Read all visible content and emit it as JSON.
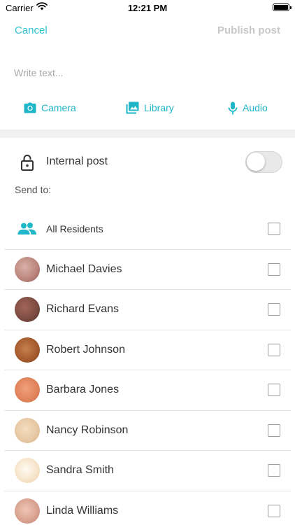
{
  "status_bar": {
    "carrier": "Carrier",
    "time": "12:21 PM"
  },
  "nav": {
    "cancel_label": "Cancel",
    "publish_label": "Publish post"
  },
  "compose": {
    "placeholder": "Write text...",
    "value": ""
  },
  "media_buttons": [
    {
      "label": "Camera",
      "icon": "camera-icon"
    },
    {
      "label": "Library",
      "icon": "photo-library-icon"
    },
    {
      "label": "Audio",
      "icon": "microphone-icon"
    }
  ],
  "internal_post": {
    "label": "Internal post",
    "enabled": false,
    "icon": "lock-icon"
  },
  "send_to": {
    "label": "Send to:"
  },
  "recipients": [
    {
      "name": "All Residents",
      "icon": "group-icon",
      "checked": false
    },
    {
      "name": "Michael Davies",
      "avatar_color": "#b9837a",
      "checked": false
    },
    {
      "name": "Richard Evans",
      "avatar_color": "#7a4a40",
      "checked": false
    },
    {
      "name": "Robert Johnson",
      "avatar_color": "#a4592c",
      "checked": false
    },
    {
      "name": "Barbara Jones",
      "avatar_color": "#e0825a",
      "checked": false
    },
    {
      "name": "Nancy Robinson",
      "avatar_color": "#e6c7a2",
      "checked": false
    },
    {
      "name": "Sandra Smith",
      "avatar_color": "#f6e3c8",
      "checked": false
    },
    {
      "name": "Linda Williams",
      "avatar_color": "#d8a08e",
      "checked": false
    }
  ],
  "colors": {
    "accent": "#1fb6c7",
    "cancel": "#2ec3d0",
    "publish_disabled": "#c8c8c8"
  }
}
